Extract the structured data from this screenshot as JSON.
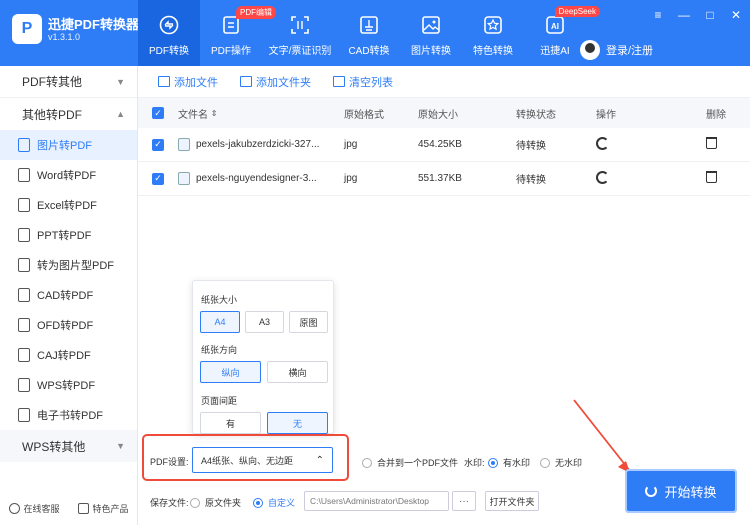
{
  "app": {
    "name": "迅捷PDF转换器",
    "version": "v1.3.1.0",
    "logo_text": "P"
  },
  "nav": [
    {
      "label": "PDF转换",
      "icon": "pdf-convert-icon",
      "badge": ""
    },
    {
      "label": "PDF操作",
      "icon": "pdf-operate-icon",
      "badge": "PDF编辑"
    },
    {
      "label": "文字/票证识别",
      "icon": "ocr-icon",
      "badge": ""
    },
    {
      "label": "CAD转换",
      "icon": "cad-icon",
      "badge": ""
    },
    {
      "label": "图片转换",
      "icon": "image-icon",
      "badge": ""
    },
    {
      "label": "特色转换",
      "icon": "special-icon",
      "badge": ""
    },
    {
      "label": "迅捷AI",
      "icon": "ai-icon",
      "badge": "DeepSeek"
    }
  ],
  "user": {
    "login_label": "登录/注册"
  },
  "window": {
    "menu": "≡",
    "minimize": "—",
    "maximize": "□",
    "close": "✕"
  },
  "sidebar": {
    "groups": [
      "PDF转其他",
      "其他转PDF",
      "WPS转其他"
    ],
    "items": [
      "图片转PDF",
      "Word转PDF",
      "Excel转PDF",
      "PPT转PDF",
      "转为图片型PDF",
      "CAD转PDF",
      "OFD转PDF",
      "CAJ转PDF",
      "WPS转PDF",
      "电子书转PDF"
    ],
    "bottom": [
      "在线客服",
      "特色产品"
    ]
  },
  "toolbar": {
    "add_file": "添加文件",
    "add_folder": "添加文件夹",
    "clear": "清空列表"
  },
  "table": {
    "headers": {
      "name": "文件名",
      "format": "原始格式",
      "size": "原始大小",
      "status": "转换状态",
      "op": "操作",
      "del": "删除"
    },
    "rows": [
      {
        "name": "pexels-jakubzerdzicki-327...",
        "format": "jpg",
        "size": "454.25KB",
        "status": "待转换"
      },
      {
        "name": "pexels-nguyendesigner-3...",
        "format": "jpg",
        "size": "551.37KB",
        "status": "待转换"
      }
    ]
  },
  "popup": {
    "paper_size_label": "纸张大小",
    "paper_sizes": [
      "A4",
      "A3",
      "原图"
    ],
    "orientation_label": "纸张方向",
    "orientations": [
      "纵向",
      "横向"
    ],
    "margin_label": "页面间距",
    "margins": [
      "有",
      "无"
    ]
  },
  "settings": {
    "pdf_label": "PDF设置:",
    "pdf_value": "A4纸张、纵向、无边距",
    "merge_label": "合并到一个PDF文件",
    "watermark_label": "水印:",
    "watermark_on": "有水印",
    "watermark_off": "无水印",
    "save_label": "保存文件:",
    "save_original": "原文件夹",
    "save_custom": "自定义",
    "path": "C:\\Users\\Administrator\\Desktop",
    "dots": "···",
    "open_folder": "打开文件夹",
    "convert": "开始转换"
  },
  "colors": {
    "primary": "#2f7df6",
    "highlight_border": "#f04a3a",
    "badge": "#ff4747"
  }
}
